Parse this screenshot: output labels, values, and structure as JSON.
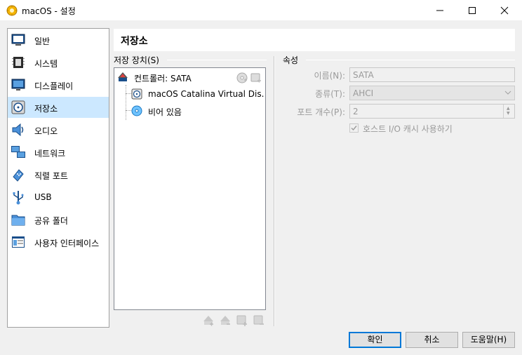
{
  "window": {
    "title": "macOS - 설정"
  },
  "sidebar": {
    "items": [
      {
        "label": "일반",
        "icon": "general-icon"
      },
      {
        "label": "시스템",
        "icon": "system-icon"
      },
      {
        "label": "디스플레이",
        "icon": "display-icon"
      },
      {
        "label": "저장소",
        "icon": "storage-icon",
        "selected": true
      },
      {
        "label": "오디오",
        "icon": "audio-icon"
      },
      {
        "label": "네트워크",
        "icon": "network-icon"
      },
      {
        "label": "직렬 포트",
        "icon": "serial-port-icon"
      },
      {
        "label": "USB",
        "icon": "usb-icon"
      },
      {
        "label": "공유 폴더",
        "icon": "shared-folder-icon"
      },
      {
        "label": "사용자 인터페이스",
        "icon": "user-interface-icon"
      }
    ]
  },
  "page": {
    "title": "저장소"
  },
  "storage": {
    "group_label": "저장 장치(S)",
    "controller": {
      "label": "컨트롤러: SATA"
    },
    "devices": [
      {
        "label": "macOS Catalina Virtual Dis...",
        "icon": "hard-disk-icon"
      },
      {
        "label": "비어 있음",
        "icon": "optical-disc-icon"
      }
    ]
  },
  "attributes": {
    "group_label": "속성",
    "name": {
      "label": "이름(N):",
      "value": "SATA"
    },
    "type": {
      "label": "종류(T):",
      "value": "AHCI"
    },
    "port_count": {
      "label": "포트 개수(P):",
      "value": "2"
    },
    "host_io_cache": {
      "label": "호스트 I/O 캐시 사용하기",
      "checked": true
    }
  },
  "buttons": {
    "ok": "확인",
    "cancel": "취소",
    "help": "도움말(H)"
  },
  "colors": {
    "selection": "#cce8ff",
    "default_button_border": "#0078d7"
  }
}
